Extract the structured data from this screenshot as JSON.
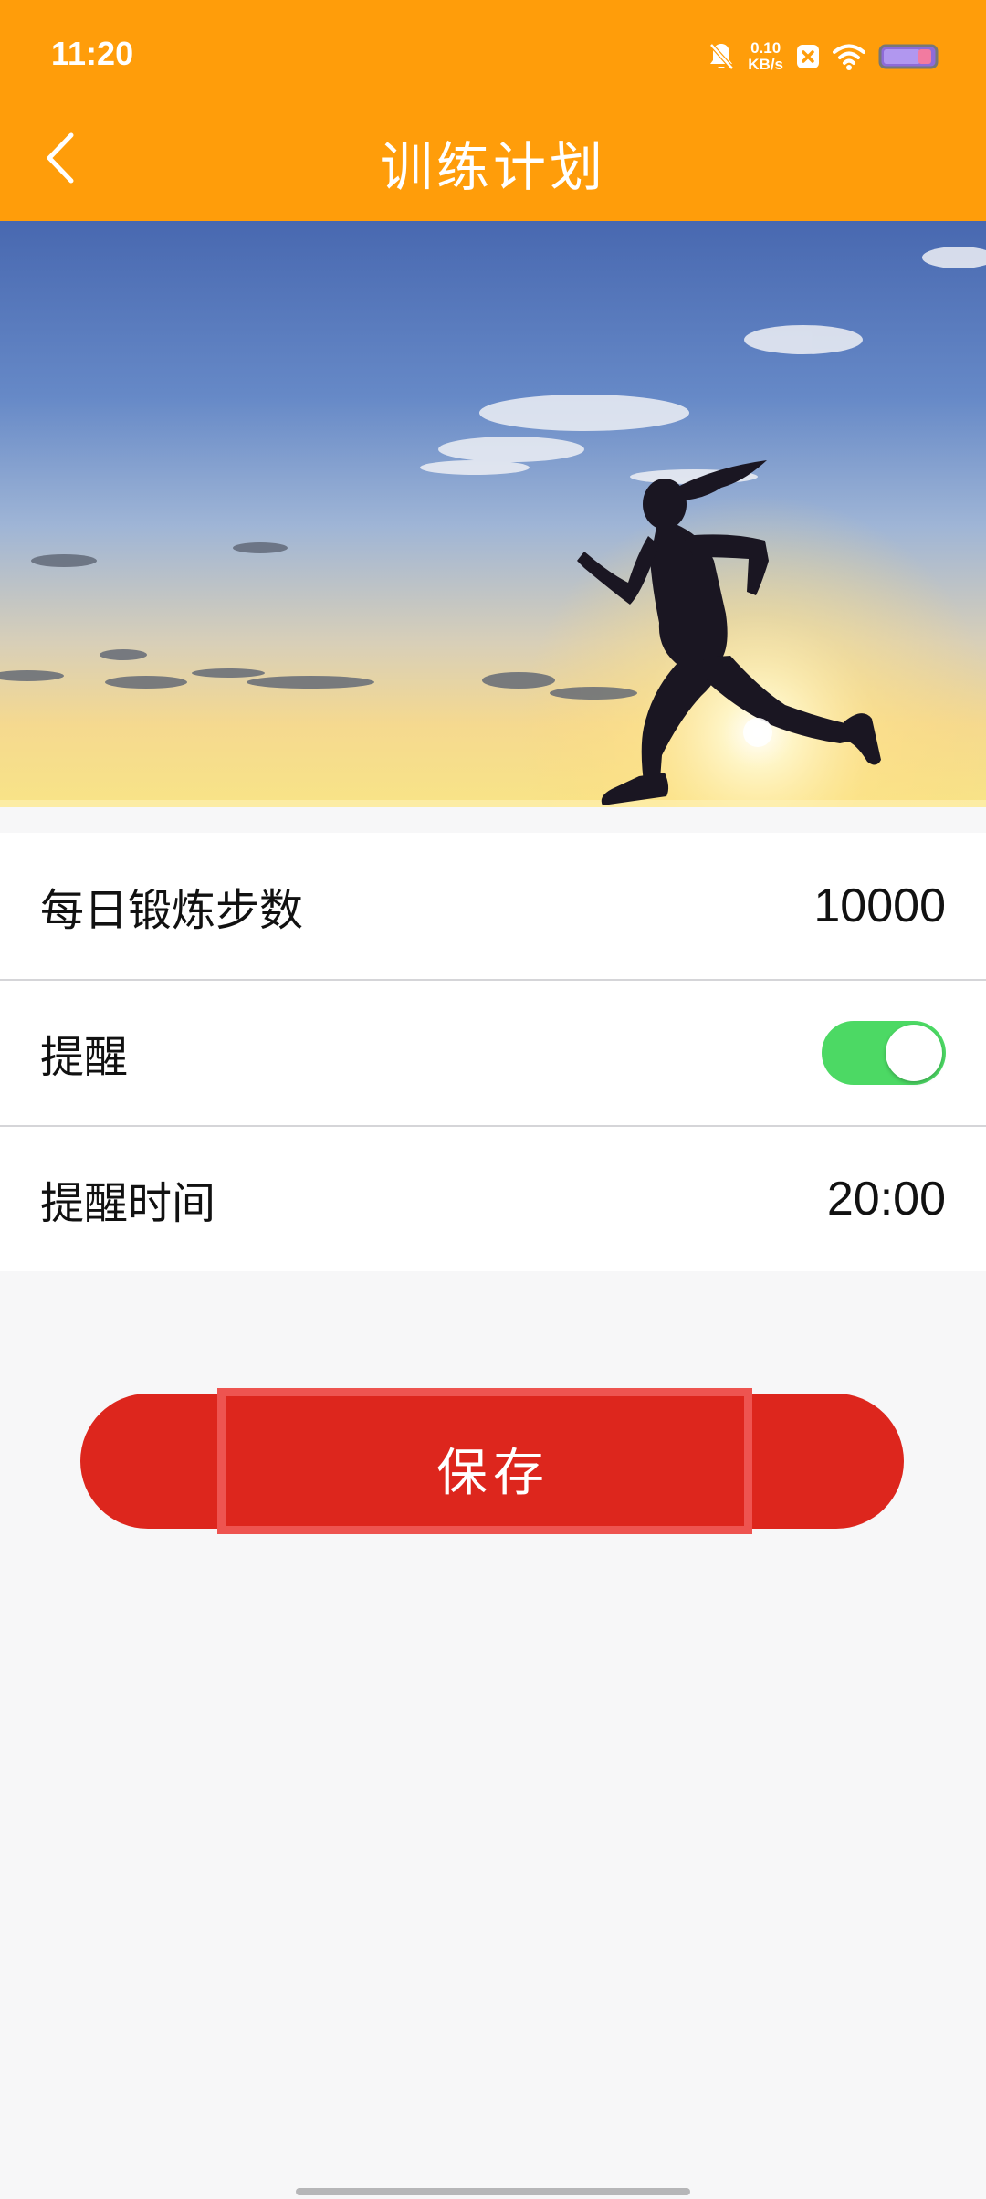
{
  "status_bar": {
    "time": "11:20",
    "net_speed_value": "0.10",
    "net_speed_unit": "KB/s",
    "icons": [
      "bell-mute-icon",
      "close-badge-icon",
      "wifi-icon",
      "battery-icon"
    ]
  },
  "header": {
    "title": "训练计划",
    "back_icon": "chevron-left-icon"
  },
  "settings": {
    "daily_steps": {
      "label": "每日锻炼步数",
      "value": "10000"
    },
    "reminder": {
      "label": "提醒",
      "enabled": true
    },
    "reminder_time": {
      "label": "提醒时间",
      "value": "20:00"
    }
  },
  "actions": {
    "save_label": "保存"
  },
  "colors": {
    "header_bg": "#ff9d0a",
    "save_button": "#dd261d",
    "toggle_on": "#4cd964",
    "page_bg": "#f7f7f8"
  }
}
